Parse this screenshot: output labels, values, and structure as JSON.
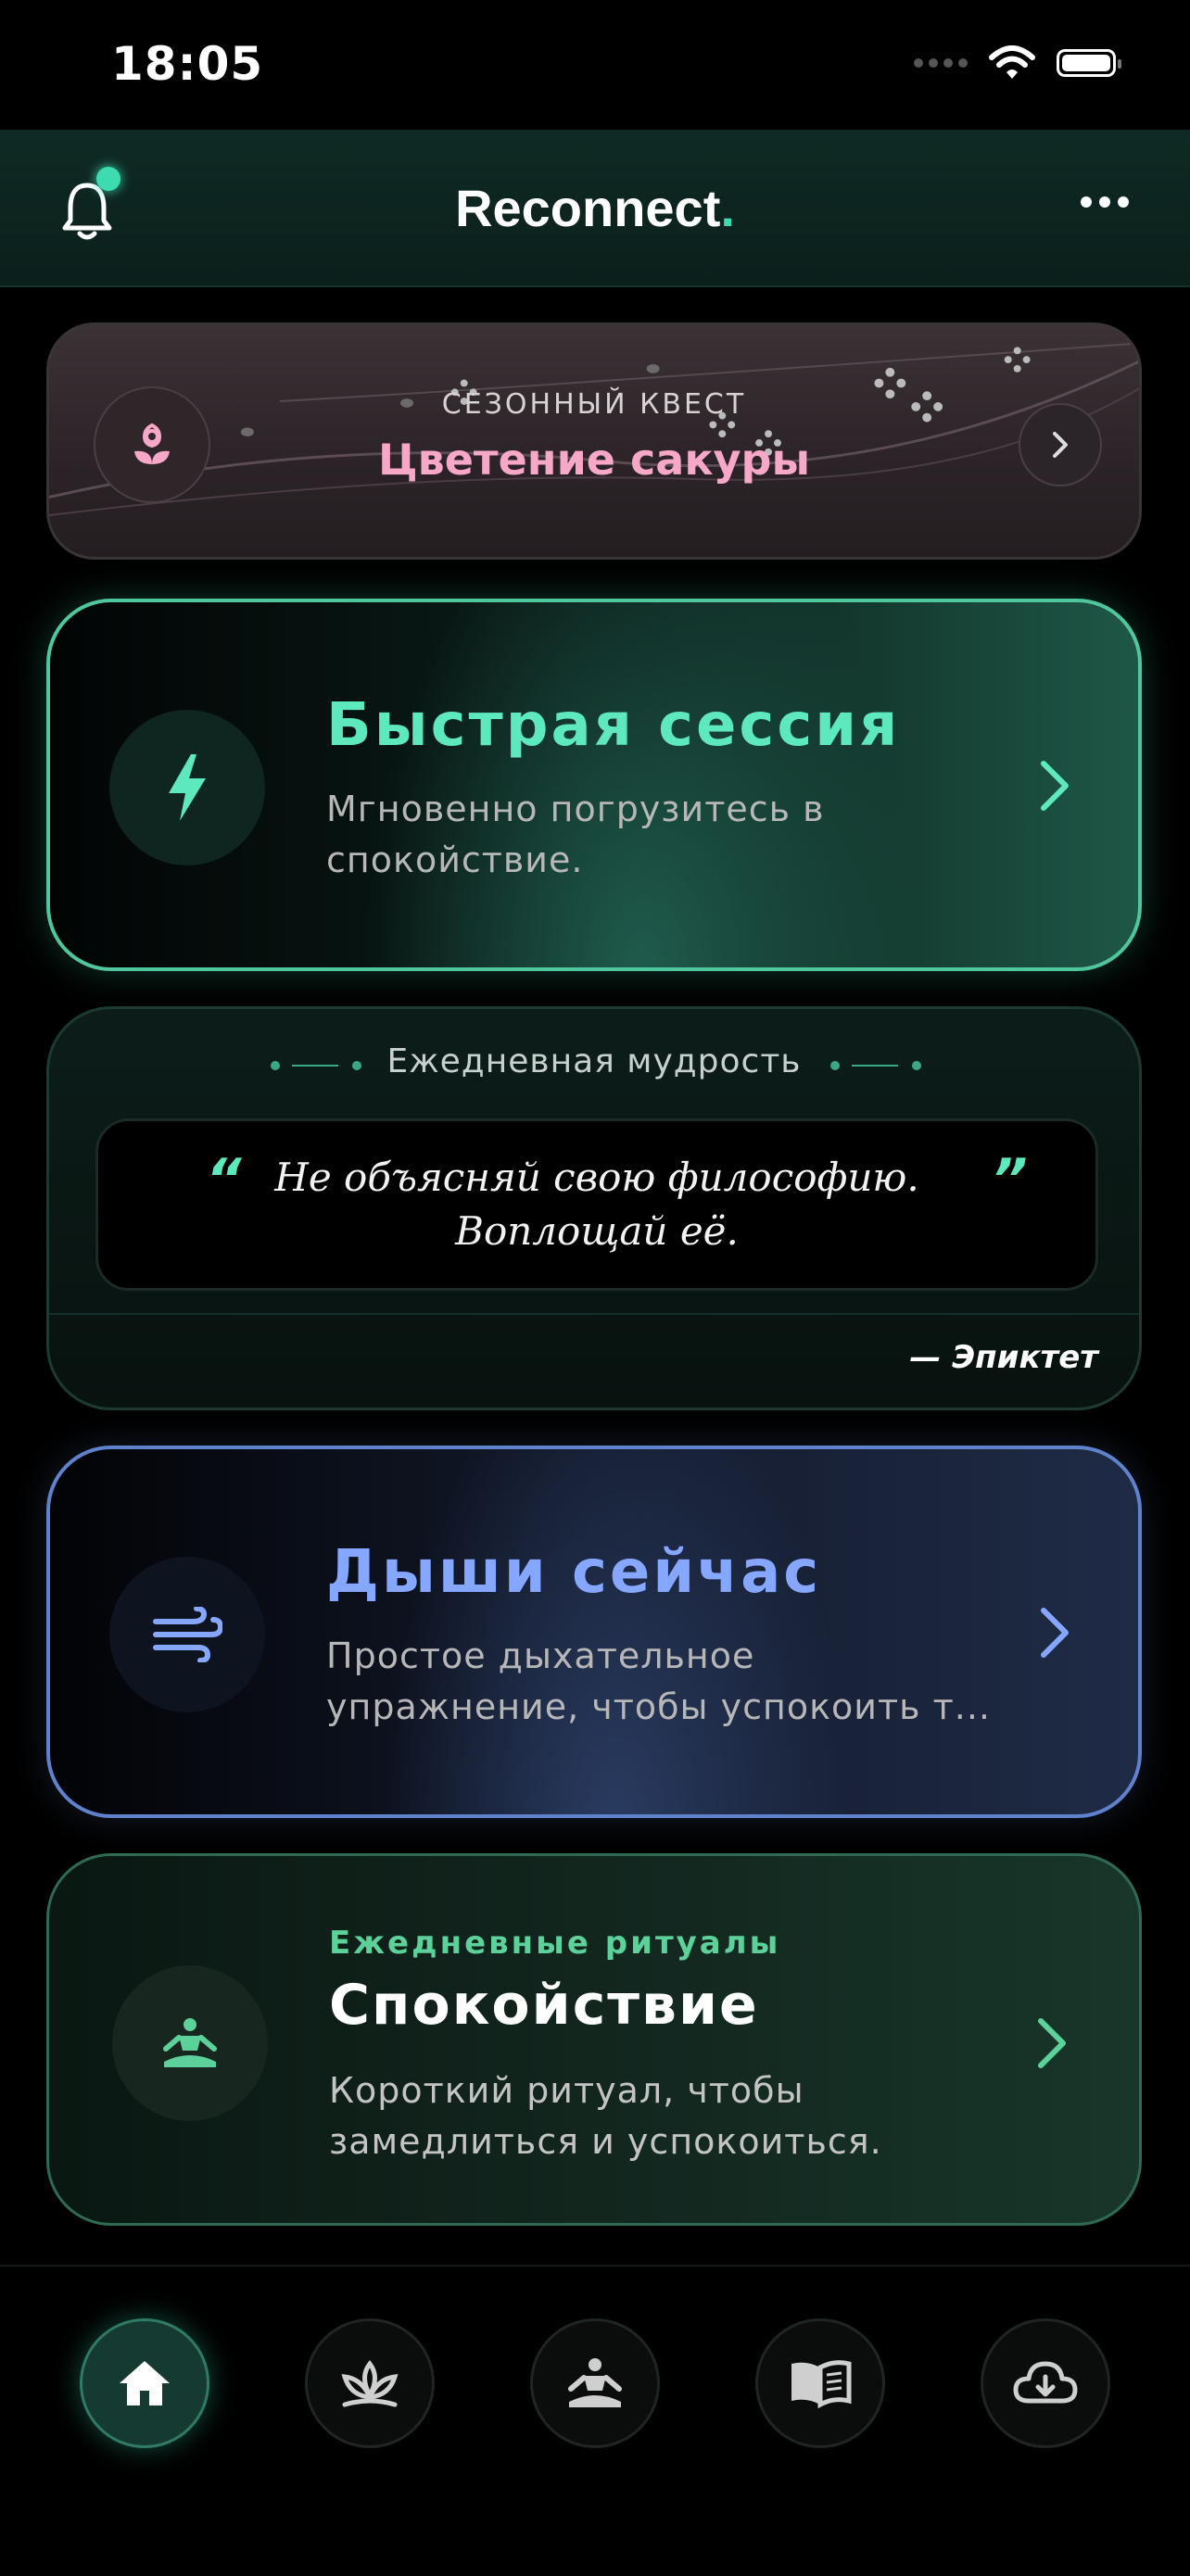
{
  "status_bar": {
    "time": "18:05"
  },
  "header": {
    "title": "Reconnect",
    "title_dot": "."
  },
  "seasonal_quest": {
    "kicker": "СЕЗОННЫЙ КВЕСТ",
    "title": "Цветение сакуры"
  },
  "quick_session": {
    "title": "Быстрая сессия",
    "desc_line1": "Мгновенно погрузитесь в",
    "desc_line2": "спокойствие."
  },
  "daily_wisdom": {
    "heading": "Ежедневная мудрость",
    "quote_line1": "Не объясняй свою философию.",
    "quote_line2": "Воплощай её.",
    "author": "— Эпиктет"
  },
  "breathe": {
    "title": "Дыши сейчас",
    "desc_line1": "Простое дыхательное",
    "desc_line2": "упражнение, чтобы успокоить т..."
  },
  "ritual": {
    "kicker": "Ежедневные ритуалы",
    "title": "Спокойствие",
    "desc_line1": "Короткий ритуал, чтобы",
    "desc_line2": "замедлиться и успокоиться."
  },
  "tabs": [
    {
      "icon": "home-icon",
      "active": true
    },
    {
      "icon": "lotus-icon",
      "active": false
    },
    {
      "icon": "meditation-icon",
      "active": false
    },
    {
      "icon": "book-icon",
      "active": false
    },
    {
      "icon": "cloud-download-icon",
      "active": false
    }
  ],
  "colors": {
    "accent": "#3ddbb0",
    "quick": "#5ee8bd",
    "breathe": "#86a7ff",
    "ritual": "#5cd29a",
    "quest": "#f7a8c8"
  }
}
